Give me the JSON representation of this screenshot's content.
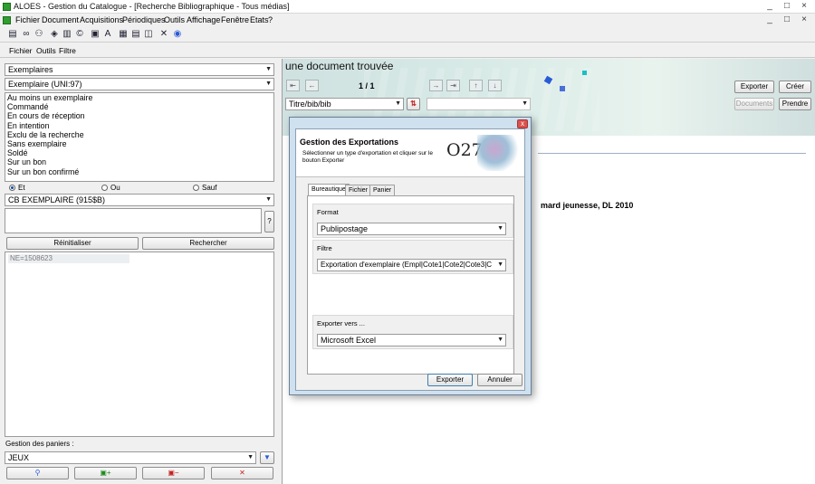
{
  "window": {
    "title": "ALOES - Gestion du Catalogue - [Recherche Bibliographique - Tous médias]",
    "controls": [
      "_",
      "□",
      "×"
    ],
    "inner_controls": [
      "_",
      "□",
      "×"
    ]
  },
  "menu": [
    {
      "label": "Fichier"
    },
    {
      "label": "Document"
    },
    {
      "label": "Acquisitions"
    },
    {
      "label": "Périodiques"
    },
    {
      "label": "Outils"
    },
    {
      "label": "Affichage"
    },
    {
      "label": "Fenêtre"
    },
    {
      "label": "Etats"
    },
    {
      "label": "?"
    }
  ],
  "toolbar_icons": [
    "document-icon",
    "binoculars-icon",
    "double-binoculars-icon",
    "tag-icon",
    "library-icon",
    "stack-icon",
    "copyright-icon",
    "book-icon",
    "font-icon",
    "window-icon",
    "window-split-icon",
    "layout-icon",
    "tools-icon",
    "globe-icon"
  ],
  "submenu": [
    {
      "label": "Fichier"
    },
    {
      "label": "Outils"
    },
    {
      "label": "Filtre"
    }
  ],
  "left": {
    "type_select": "Exemplaires",
    "field_select": "Exemplaire (UNI:97)",
    "options": [
      "Au moins un exemplaire",
      "Commandé",
      "En cours de réception",
      "En intention",
      "Exclu de la recherche",
      "Sans exemplaire",
      "Soldé",
      "Sur un bon",
      "Sur un bon confirmé"
    ],
    "operators": [
      {
        "label": "Et",
        "checked": true
      },
      {
        "label": "Ou",
        "checked": false
      },
      {
        "label": "Sauf",
        "checked": false
      }
    ],
    "criteria_select": "CB EXEMPLAIRE (915$B)",
    "help_label": "?",
    "reset_button": "Réinitialiser",
    "search_button": "Rechercher",
    "query_text": "NE=1508623",
    "baskets_label": "Gestion des paniers :",
    "basket_value": "JEUX"
  },
  "right": {
    "result_title": "une document trouvée",
    "page_indicator": "1 / 1",
    "sort_select": "Titre/bib/bib",
    "buttons": {
      "export": "Exporter",
      "create": "Créer",
      "documents": "Documents",
      "take": "Prendre"
    },
    "record_fragment": "mard jeunesse, DL 2010"
  },
  "dialog": {
    "title": "Gestion des Exportations",
    "description": "Sélectionner un type d'exportation et cliquer sur le bouton Exporter",
    "logo_text": "O27",
    "close_label": "x",
    "tabs": [
      {
        "label": "Bureautique"
      },
      {
        "label": "Fichier"
      },
      {
        "label": "Panier"
      }
    ],
    "format_label": "Format",
    "format_value": "Publipostage",
    "filter_label": "Filtre",
    "filter_value": "Exportation d'exemplaire (Empl|Cote1|Cote2|Cote3|C",
    "export_to_label": "Exporter vers ...",
    "export_to_value": "Microsoft Excel",
    "export_button": "Exporter",
    "cancel_button": "Annuler"
  },
  "colors": {
    "banner": "#d9ebe7",
    "accent_blue": "#2a5bd7",
    "accent_cyan": "#1bbfc4",
    "app_green": "#2f9e2f"
  }
}
